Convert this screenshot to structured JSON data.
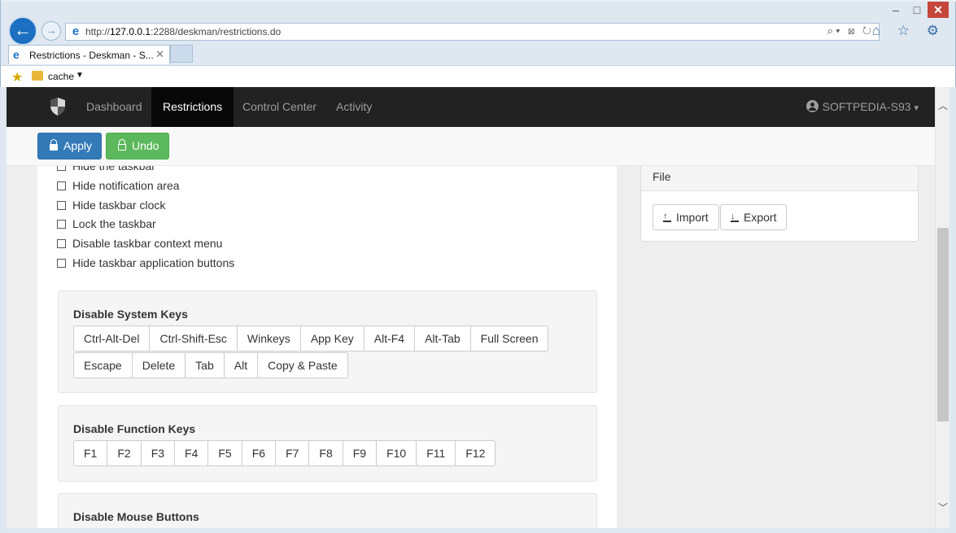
{
  "browser": {
    "url_prefix": "http://",
    "url_host": "127.0.0.1",
    "url_rest": ":2288/deskman/restrictions.do",
    "tab_title": "Restrictions - Deskman - S...",
    "favorites": {
      "folder_label": "cache"
    },
    "window_buttons": {
      "minimize": "–",
      "maximize": "□",
      "close": "✕"
    },
    "address_tools": "⌕▾ ⊠ ↻",
    "toolbar_icons": "⌂ ☆ ⚙"
  },
  "appnav": {
    "links": [
      "Dashboard",
      "Restrictions",
      "Control Center",
      "Activity"
    ],
    "active": "Restrictions",
    "user": "SOFTPEDIA-S93",
    "user_caret": "▾"
  },
  "toolbar": {
    "apply_label": "Apply",
    "undo_label": "Undo"
  },
  "taskbar_options": [
    "Hide the taskbar",
    "Hide notification area",
    "Hide taskbar clock",
    "Lock the taskbar",
    "Disable taskbar context menu",
    "Hide taskbar application buttons"
  ],
  "system_keys": {
    "title": "Disable System Keys",
    "row1": [
      "Ctrl-Alt-Del",
      "Ctrl-Shift-Esc",
      "Winkeys",
      "App Key",
      "Alt-F4",
      "Alt-Tab",
      "Full Screen"
    ],
    "row2": [
      "Escape",
      "Delete",
      "Tab",
      "Alt",
      "Copy & Paste"
    ]
  },
  "function_keys": {
    "title": "Disable Function Keys",
    "keys": [
      "F1",
      "F2",
      "F3",
      "F4",
      "F5",
      "F6",
      "F7",
      "F8",
      "F9",
      "F10",
      "F11",
      "F12"
    ]
  },
  "mouse_buttons": {
    "title": "Disable Mouse Buttons"
  },
  "file_panel": {
    "title": "File",
    "import_label": "Import",
    "export_label": "Export"
  },
  "colors": {
    "primary": "#337ab7",
    "success": "#5cb85c",
    "navbar": "#222222"
  }
}
